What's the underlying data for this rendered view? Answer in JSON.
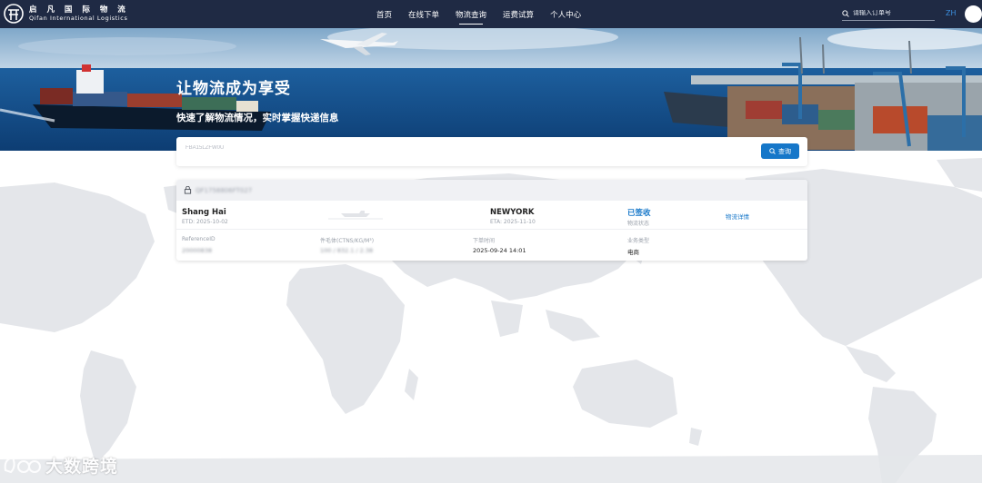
{
  "nav": {
    "logo_cn": "启 凡 国 际 物 流",
    "logo_en": "Qifan International Logistics",
    "links": [
      {
        "label": "首页",
        "active": false
      },
      {
        "label": "在线下单",
        "active": false
      },
      {
        "label": "物流查询",
        "active": true
      },
      {
        "label": "运费试算",
        "active": false
      },
      {
        "label": "个人中心",
        "active": false
      }
    ],
    "search_placeholder": "请输入订单号",
    "lang": "ZH"
  },
  "hero": {
    "title": "让物流成为享受",
    "subtitle": "快速了解物流情况，实时掌握快递信息"
  },
  "search": {
    "value": "FBA15LZFW0U",
    "button_label": "查询"
  },
  "result": {
    "order_no": "QF1758806FT027",
    "pol": "Shang Hai",
    "etd": "ETD: 2025-10-02",
    "pod": "NEWYORK",
    "eta": "ETA: 2025-11-10",
    "status": "已签收",
    "status_label": "物流状态",
    "detail_link": "物流详情",
    "fields": [
      {
        "label": "ReferenceID",
        "value": "20000838"
      },
      {
        "label": "件毛体(CTNS/KG/M³)",
        "value": "100 / 832.1 / 2.38"
      },
      {
        "label": "下单时间",
        "value": "2025-09-24 14:01"
      },
      {
        "label": "业务类型",
        "value": "电商"
      }
    ]
  },
  "watermark": {
    "text": "大数跨境"
  },
  "colors": {
    "nav_bg": "#1f2a44",
    "accent": "#1677c9",
    "map": "#e4e6ea"
  }
}
